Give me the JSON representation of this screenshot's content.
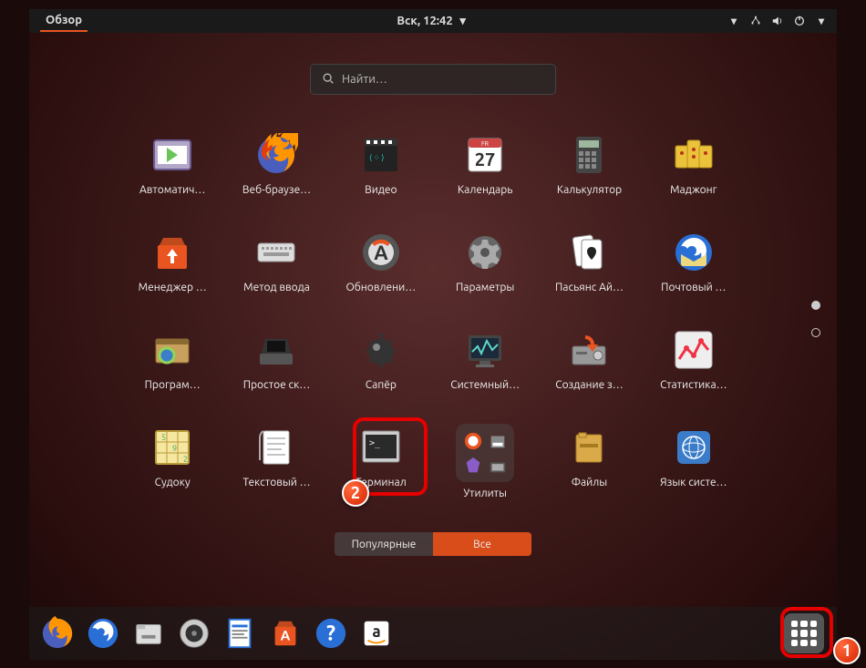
{
  "topbar": {
    "activities": "Обзор",
    "clock": "Вск, 12:42",
    "dropdown_icon": "chevron-down",
    "network_icon": "network",
    "volume_icon": "volume",
    "power_icon": "power"
  },
  "search": {
    "placeholder": "Найти…",
    "icon": "search"
  },
  "apps": [
    {
      "id": "autostart",
      "label": "Автоматич…"
    },
    {
      "id": "firefox",
      "label": "Веб-браузе…"
    },
    {
      "id": "videos",
      "label": "Видео"
    },
    {
      "id": "calendar",
      "label": "Календарь",
      "calendar_day": "27",
      "calendar_dow": "FR"
    },
    {
      "id": "calculator",
      "label": "Калькулятор"
    },
    {
      "id": "mahjongg",
      "label": "Маджонг"
    },
    {
      "id": "software",
      "label": "Менеджер …"
    },
    {
      "id": "ibus",
      "label": "Метод ввода"
    },
    {
      "id": "updater",
      "label": "Обновлени…"
    },
    {
      "id": "settings",
      "label": "Параметры"
    },
    {
      "id": "aisleriot",
      "label": "Пасьянс Ай…"
    },
    {
      "id": "thunderbird",
      "label": "Почтовый …"
    },
    {
      "id": "ubuntu-additional",
      "label": "Програм…"
    },
    {
      "id": "scanner",
      "label": "Простое ск…"
    },
    {
      "id": "mines",
      "label": "Сапёр"
    },
    {
      "id": "monitor",
      "label": "Системный…"
    },
    {
      "id": "backup",
      "label": "Создание з…"
    },
    {
      "id": "stats",
      "label": "Статистика…"
    },
    {
      "id": "sudoku",
      "label": "Судоку"
    },
    {
      "id": "gedit",
      "label": "Текстовый …"
    },
    {
      "id": "terminal",
      "label": "Терминал"
    },
    {
      "id": "utilities",
      "label": "Утилиты"
    },
    {
      "id": "files",
      "label": "Файлы"
    },
    {
      "id": "locale",
      "label": "Язык систе…"
    }
  ],
  "tabs": {
    "frequent": "Популярные",
    "all": "Все",
    "active": "all"
  },
  "dock": [
    {
      "id": "firefox",
      "name": "firefox-icon"
    },
    {
      "id": "thunderbird",
      "name": "thunderbird-icon"
    },
    {
      "id": "files",
      "name": "files-icon"
    },
    {
      "id": "rhythmbox",
      "name": "rhythmbox-icon"
    },
    {
      "id": "libreoffice",
      "name": "libreoffice-writer-icon"
    },
    {
      "id": "software",
      "name": "software-icon"
    },
    {
      "id": "help",
      "name": "help-icon"
    },
    {
      "id": "amazon",
      "name": "amazon-icon"
    }
  ],
  "callouts": {
    "1": "1",
    "2": "2"
  },
  "pager": {
    "current": 1,
    "total": 2
  }
}
